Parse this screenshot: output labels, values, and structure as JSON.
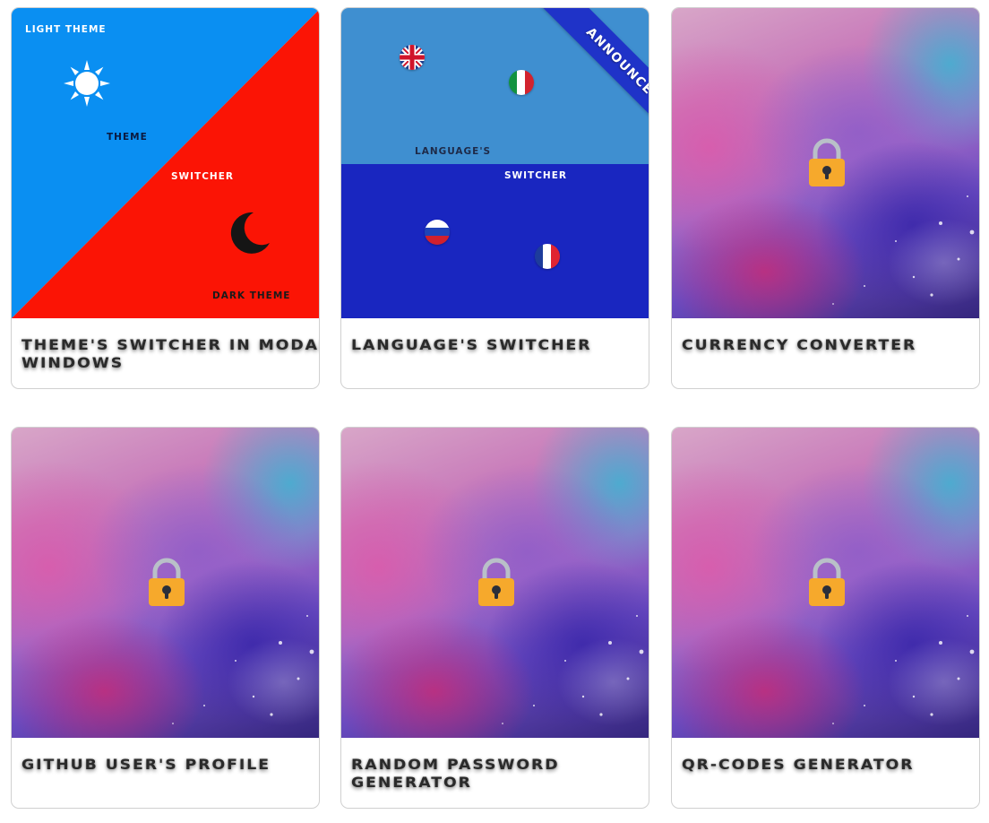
{
  "cards": [
    {
      "title": "THEME'S SWITCHER IN MODAL WINDOWS",
      "thumb": {
        "light_label": "LIGHT THEME",
        "word1": "THEME",
        "word2": "SWITCHER",
        "dark_label": "DARK THEME",
        "light_color": "#0a8ff2",
        "dark_color": "#fb1405"
      }
    },
    {
      "title": "LANGUAGE'S SWITCHER",
      "thumb": {
        "ribbon": "ANNOUNCED",
        "word1": "LANGUAGE'S",
        "word2": "SWITCHER",
        "top_color": "#3f8fd0",
        "bottom_color": "#1926c0",
        "flags": [
          "uk-flag",
          "italy-flag",
          "russia-flag",
          "france-flag"
        ]
      }
    },
    {
      "title": "CURRENCY CONVERTER",
      "locked": true
    },
    {
      "title": "GITHUB USER'S PROFILE",
      "locked": true
    },
    {
      "title": "RANDOM PASSWORD GENERATOR",
      "locked": true
    },
    {
      "title": "QR-CODES GENERATOR",
      "locked": true
    }
  ]
}
